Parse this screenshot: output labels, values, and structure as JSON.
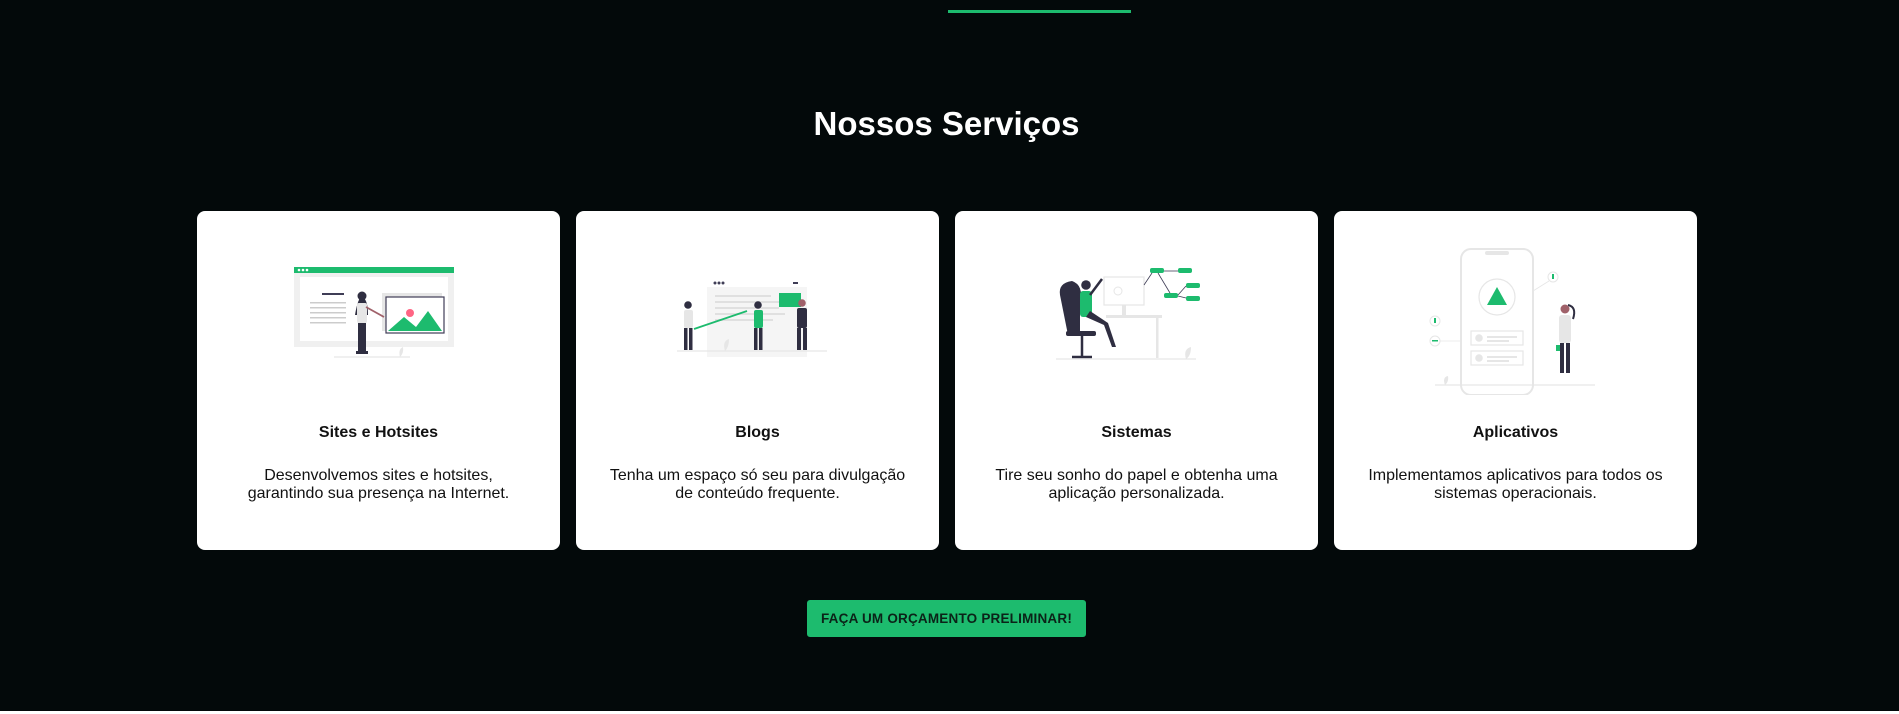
{
  "section": {
    "title": "Nossos Serviços"
  },
  "services": [
    {
      "icon": "website-presentation-illustration",
      "title": "Sites e Hotsites",
      "description": "Desenvolvemos sites e hotsites, garantindo sua presença na Internet."
    },
    {
      "icon": "blog-team-illustration",
      "title": "Blogs",
      "description": "Tenha um espaço só seu para divulgação de conteúdo frequente."
    },
    {
      "icon": "system-developer-illustration",
      "title": "Sistemas",
      "description": "Tire seu sonho do papel e obtenha uma aplicação personalizada."
    },
    {
      "icon": "mobile-app-illustration",
      "title": "Aplicativos",
      "description": "Implementamos aplicativos para todos os sistemas operacionais."
    }
  ],
  "cta": {
    "label": "FAÇA UM ORÇAMENTO PRELIMINAR!"
  },
  "colors": {
    "background": "#03090a",
    "accent": "#1dbb6e",
    "card": "#ffffff"
  }
}
